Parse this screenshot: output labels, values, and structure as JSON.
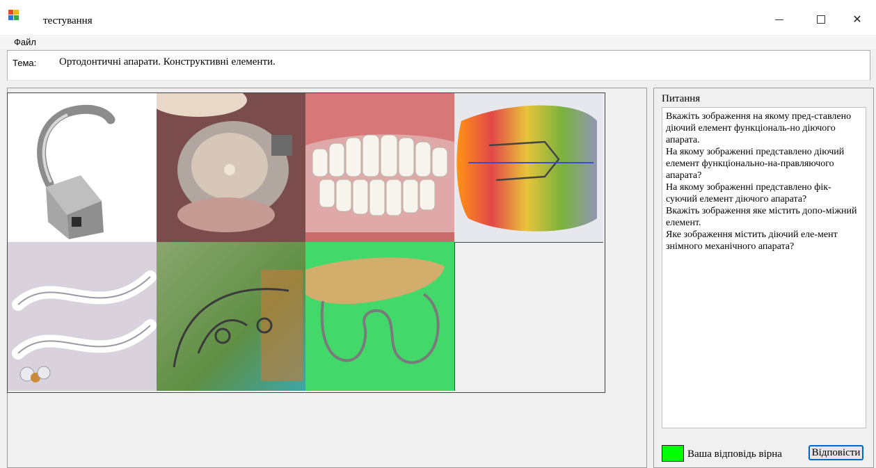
{
  "window": {
    "title": "тестування",
    "icon": "app-grid-icon",
    "controls": {
      "minimize": "minimize-icon",
      "maximize": "maximize-icon",
      "close": "close-icon"
    }
  },
  "menu": {
    "items": [
      {
        "label": "Файл"
      }
    ]
  },
  "topic": {
    "label": "Тема:",
    "value": "Ортодонтичні апарати. Конструктивні елементи."
  },
  "gallery": {
    "images": [
      {
        "name": "metal-hook-image"
      },
      {
        "name": "tooth-crown-image"
      },
      {
        "name": "dentures-image"
      },
      {
        "name": "colorful-appliance-image"
      },
      {
        "name": "twisted-wire-image"
      },
      {
        "name": "wire-spring-appliance-image"
      },
      {
        "name": "acrylic-plate-loop-image"
      },
      {
        "name": "empty-cell"
      }
    ]
  },
  "questions": {
    "label": "Питання",
    "items": [
      {
        "text": "Вкажіть зображення на якому пред-ставлено діючий елемент функціональ-но діючого апарата."
      },
      {
        "text": "На якому зображенні представлено діючий елемент функціонально-на-правляючого апарата?"
      },
      {
        "text": "На якому зображенні представлено фік-суючий елемент діючого апарата?"
      },
      {
        "text": "Вкажіть зображення яке містить допо-міжний елемент."
      },
      {
        "text": "Яке зображення містить діючий еле-мент знімного механічного апарата?"
      }
    ]
  },
  "result": {
    "color": "#00ff00",
    "text": "Ваша відповідь вірна"
  },
  "answer_button": {
    "label": "Відповісти"
  }
}
